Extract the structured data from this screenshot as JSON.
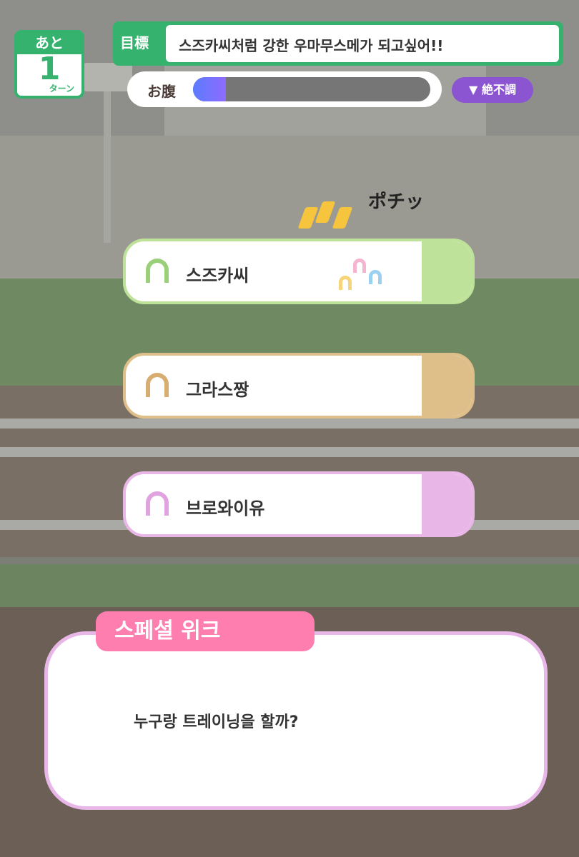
{
  "turn": {
    "top_label": "あと",
    "count": "1",
    "unit_label": "ターン"
  },
  "goal": {
    "label": "目標",
    "text": "스즈카씨처럼 강한 우마무스메가 되고싶어!!"
  },
  "hunger": {
    "label": "お腹",
    "level": 0.14,
    "status": "絶不調"
  },
  "effect": {
    "pochi_text": "ポチッ"
  },
  "options": [
    {
      "name": "스즈카씨",
      "color": "#bfe29a"
    },
    {
      "name": "그라스짱",
      "color": "#dfbf89"
    },
    {
      "name": "브로와이유",
      "color": "#e8b7e8"
    }
  ],
  "dialog": {
    "title": "스페셜 위크",
    "message": "누구랑 트레이닝을 할까?"
  }
}
